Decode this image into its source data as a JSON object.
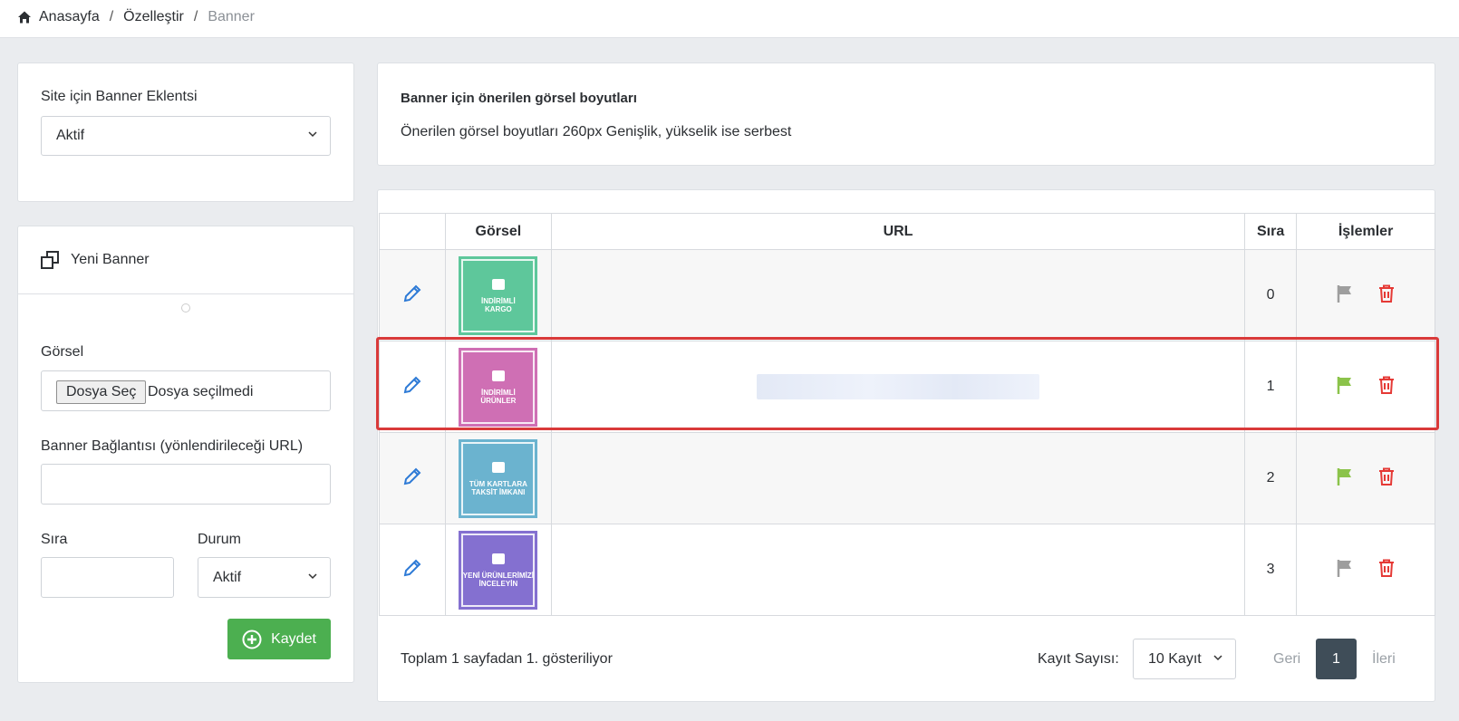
{
  "breadcrumb": {
    "home": "Anasayfa",
    "section": "Özelleştir",
    "current": "Banner",
    "separator": "/"
  },
  "plugin_card": {
    "label": "Site için Banner Eklentsi",
    "select_value": "Aktif"
  },
  "new_banner": {
    "title": "Yeni Banner",
    "image_label": "Görsel",
    "file_button": "Dosya Seç",
    "file_status": "Dosya seçilmedi",
    "link_label": "Banner Bağlantısı (yönlendirileceği URL)",
    "order_label": "Sıra",
    "status_label": "Durum",
    "status_value": "Aktif",
    "save_label": "Kaydet"
  },
  "info_card": {
    "title": "Banner için önerilen görsel boyutları",
    "text": "Önerilen görsel boyutları 260px Genişlik, yükselik ise serbest"
  },
  "table": {
    "headers": {
      "image": "Görsel",
      "url": "URL",
      "order": "Sıra",
      "actions": "İşlemler"
    },
    "rows": [
      {
        "thumb_line1": "İNDİRİMLİ",
        "thumb_line2": "KARGO",
        "thumb_color": "#5ec79b",
        "order": "0",
        "flag_color": "#9e9e9e"
      },
      {
        "thumb_line1": "İNDİRİMLİ",
        "thumb_line2": "ÜRÜNLER",
        "thumb_color": "#cf6fb4",
        "order": "1",
        "flag_color": "#8bc34a"
      },
      {
        "thumb_line1": "TÜM KARTLARA",
        "thumb_line2": "TAKSİT İMKANI",
        "thumb_color": "#6bb3cf",
        "order": "2",
        "flag_color": "#8bc34a"
      },
      {
        "thumb_line1": "YENİ ÜRÜNLERİMİZİ",
        "thumb_line2": "İNCELEYİN",
        "thumb_color": "#8470d0",
        "order": "3",
        "flag_color": "#9e9e9e"
      }
    ]
  },
  "footer": {
    "summary": "Toplam 1 sayfadan 1. gösteriliyor",
    "records_label": "Kayıt Sayısı:",
    "records_value": "10 Kayıt",
    "prev": "Geri",
    "current_page": "1",
    "next": "İleri"
  },
  "colors": {
    "accent_green": "#4caf50",
    "edit_blue": "#2d7ad6",
    "delete_red": "#e53935",
    "highlight_red": "#d93a3a"
  }
}
